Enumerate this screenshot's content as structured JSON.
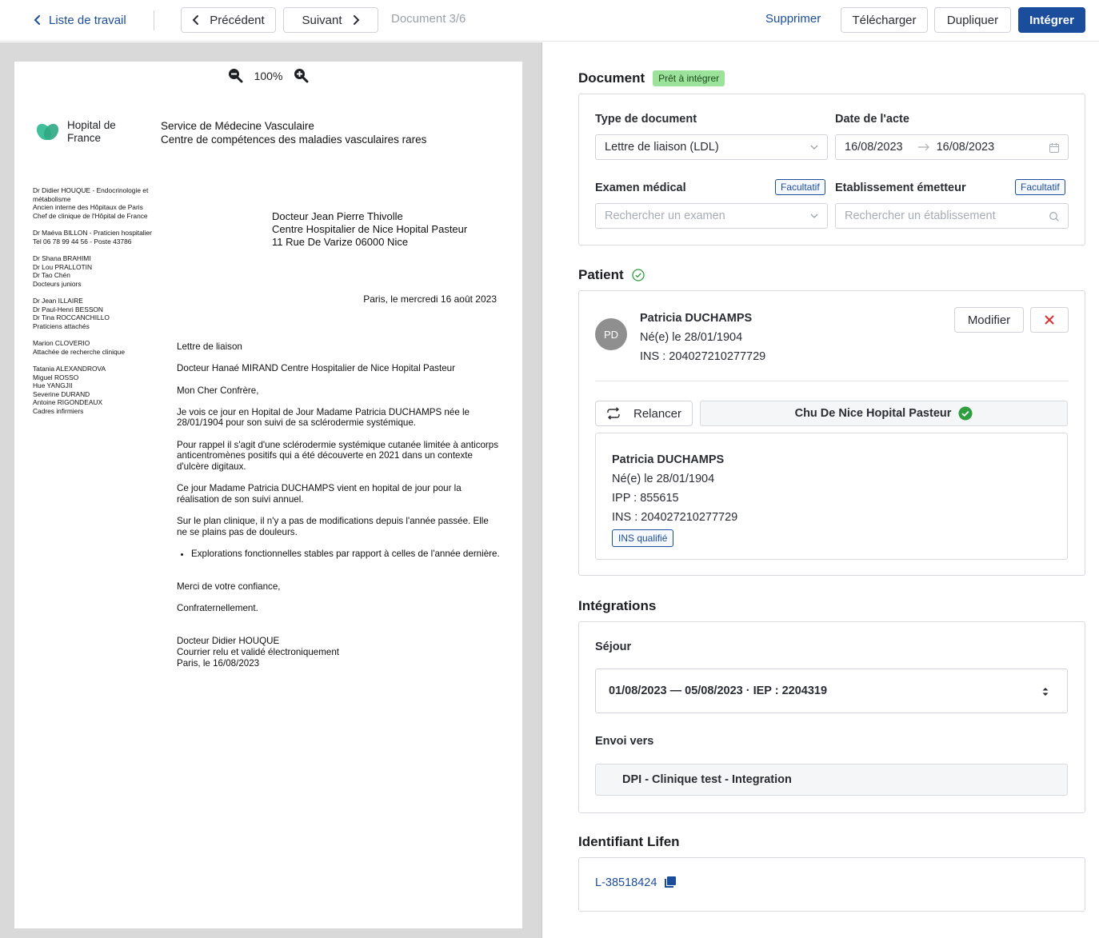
{
  "toolbar": {
    "back_label": "Liste de travail",
    "prev_label": "Précédent",
    "next_label": "Suivant",
    "doc_counter": "Document 3/6",
    "delete_label": "Supprimer",
    "download_label": "Télécharger",
    "duplicate_label": "Dupliquer",
    "integrate_label": "Intégrer"
  },
  "viewer": {
    "zoom_level": "100%",
    "letter": {
      "logo_line1": "Hopital de",
      "logo_line2": "France",
      "service_line1": "Service de Médecine Vasculaire",
      "service_line2": "Centre de compétences des maladies vasculaires rares",
      "sidebar": [
        [
          "Dr Didier HOUQUE - Endocrinologie et",
          "métabolisme",
          "Ancien interne des Hôpitaux de Paris",
          "Chef de clinique de l'Hôpital de France"
        ],
        [
          "Dr Maéva BILLON - Praticien hospitalier",
          "Tel 06 78 99 44 56 - Poste 43786"
        ],
        [
          "Dr Shana BRAHIMI",
          "Dr Lou PRALLOTIN",
          "Dr Tao Chén",
          "Docteurs juniors"
        ],
        [
          "Dr Jean ILLAIRE",
          "Dr Paul-Henri BESSON",
          "Dr Tina ROCCANCHILLO",
          "Praticiens attachés"
        ],
        [
          "Marion CLOVERIO",
          "Attachée de recherche clinique"
        ],
        [
          "Tatania ALEXANDROVA",
          "Miguel ROSSO",
          "Hue YANGJII",
          "Severine DURAND",
          "Antoine RIGONDEAUX",
          "Cadres infirmiers"
        ]
      ],
      "recipient_line1": "Docteur Jean Pierre Thivolle",
      "recipient_line2": "Centre Hospitalier de Nice Hopital Pasteur",
      "recipient_line3": "11 Rue De Varize 06000 Nice",
      "date_line": "Paris, le mercredi 16 août 2023",
      "subject": "Lettre de liaison",
      "to": "Docteur Hanaé MIRAND Centre Hospitalier de Nice Hopital Pasteur",
      "greeting": "Mon Cher Confrère,",
      "p1": "Je vois ce jour en Hopital de Jour Madame Patricia DUCHAMPS née le 28/01/1904 pour son suivi de sa sclérodermie systémique.",
      "p2": "Pour rappel il s'agit d'une sclérodermie systémique cutanée limitée à anticorps anticentromènes positifs qui a été découverte en 2021 dans un contexte d'ulcère digitaux.",
      "p3": "Ce jour Madame Patricia DUCHAMPS vient en hopital de jour pour la réalisation de son suivi annuel.",
      "p4": "Sur le plan clinique, il n'y a pas de modifications depuis l'année passée. Elle ne se plains pas de douleurs.",
      "bullet": "Explorations fonctionnelles stables par rapport à celles de l'année dernière.",
      "thanks": "Merci de votre confiance,",
      "closing": "Confraternellement.",
      "sig1": "Docteur Didier HOUQUE",
      "sig2": "Courrier relu et validé électroniquement",
      "sig3": "Paris, le 16/08/2023"
    }
  },
  "document": {
    "title": "Document",
    "status": "Prêt à intégrer",
    "type_label": "Type de document",
    "type_value": "Lettre de liaison (LDL)",
    "date_label": "Date de l'acte",
    "date_from": "16/08/2023",
    "date_to": "16/08/2023",
    "exam_label": "Examen médical",
    "exam_placeholder": "Rechercher un examen",
    "optional_badge": "Facultatif",
    "estab_label": "Etablissement émetteur",
    "estab_placeholder": "Rechercher un établissement"
  },
  "patient": {
    "title": "Patient",
    "initials": "PD",
    "name": "Patricia DUCHAMPS",
    "birth": "Né(e) le 28/01/1904",
    "ins": "INS : 204027210277729",
    "edit_label": "Modifier",
    "relaunch_label": "Relancer",
    "establishment": "Chu De Nice Hopital Pasteur",
    "ipp_name": "Patricia DUCHAMPS",
    "ipp_birth": "Né(e) le 28/01/1904",
    "ipp": "IPP : 855615",
    "ipp_ins": "INS : 204027210277729",
    "ins_badge": "INS qualifié"
  },
  "integrations": {
    "title": "Intégrations",
    "stay_label": "Séjour",
    "stay_value": "01/08/2023 — 05/08/2023 · IEP : 2204319",
    "send_label": "Envoi vers",
    "send_value": "DPI - Clinique test - Integration"
  },
  "lifen": {
    "title": "Identifiant Lifen",
    "id": "L-38518424"
  },
  "colors": {
    "primary": "#1a4d9b",
    "link": "#1c4d9a",
    "success": "#2e9e3e",
    "ready_badge": "#9be29b",
    "danger": "#e03030",
    "logo": "#3fbf9a"
  }
}
